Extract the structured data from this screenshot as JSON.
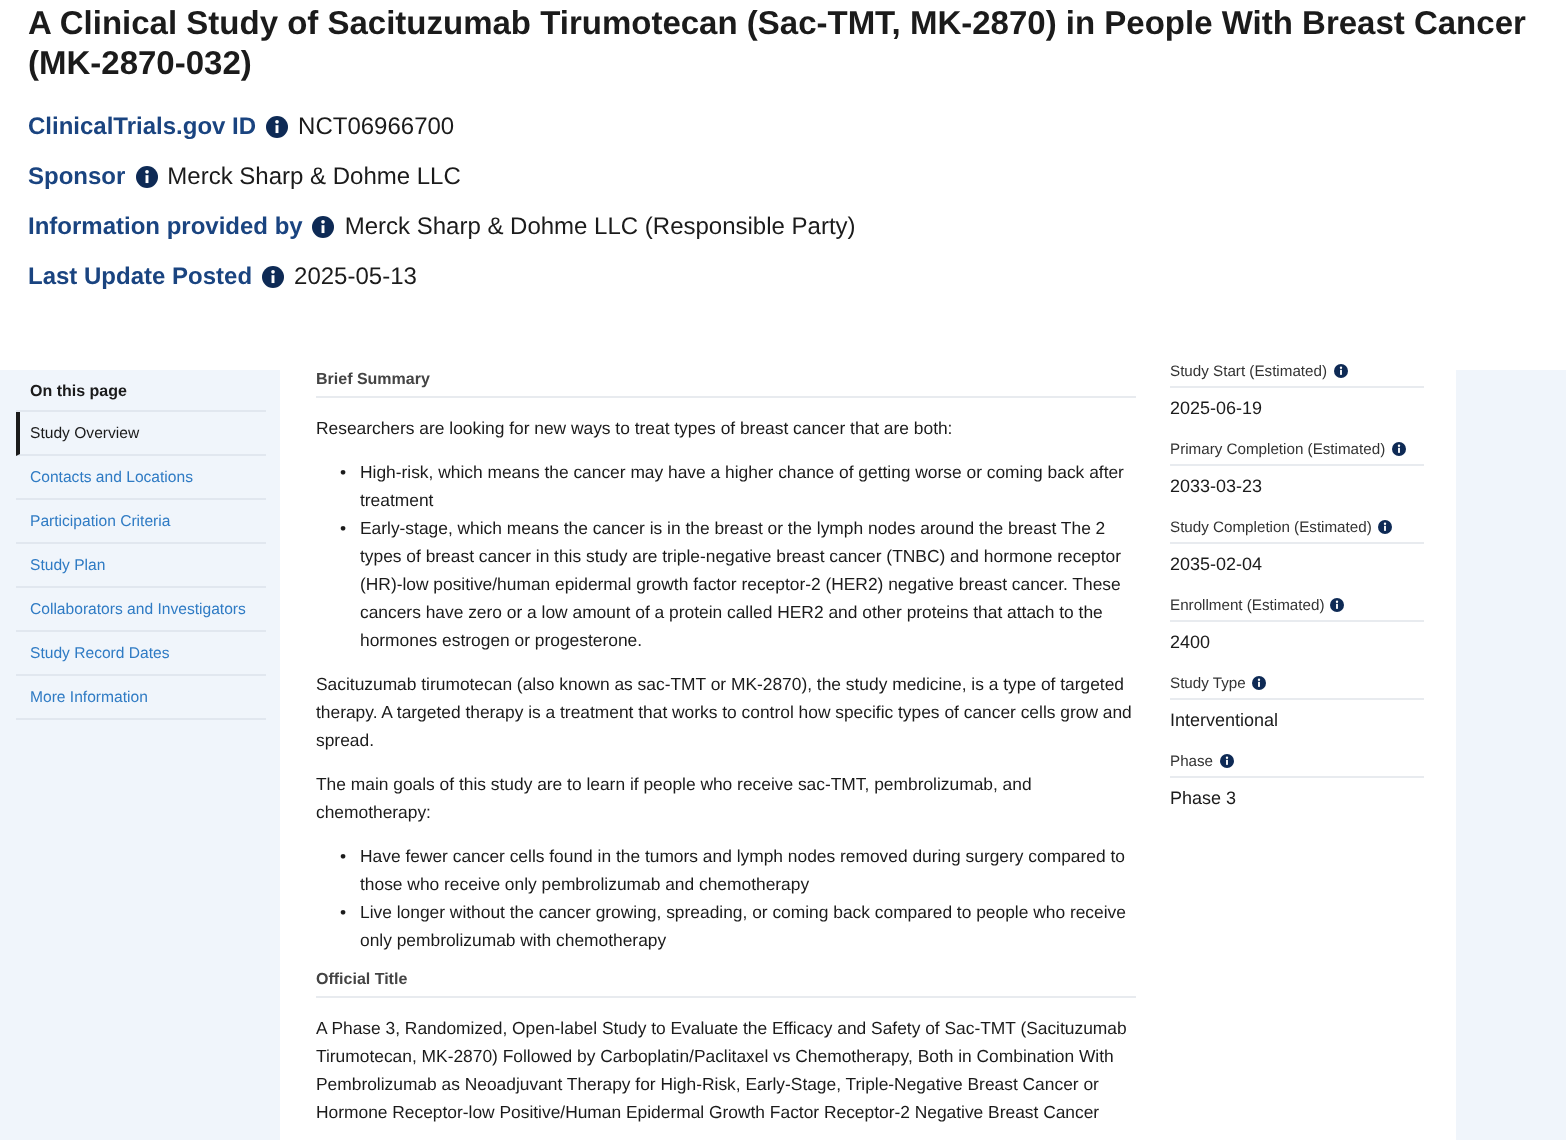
{
  "title": "A Clinical Study of Sacituzumab Tirumotecan (Sac-TMT, MK-2870) in People With Breast Cancer (MK-2870-032)",
  "meta": [
    {
      "label": "ClinicalTrials.gov ID",
      "value": "NCT06966700"
    },
    {
      "label": "Sponsor",
      "value": "Merck Sharp & Dohme LLC"
    },
    {
      "label": "Information provided by",
      "value": "Merck Sharp & Dohme LLC (Responsible Party)"
    },
    {
      "label": "Last Update Posted",
      "value": "2025-05-13"
    }
  ],
  "sidebar": {
    "heading": "On this page",
    "items": [
      {
        "label": "Study Overview",
        "selected": true
      },
      {
        "label": "Contacts and Locations",
        "selected": false
      },
      {
        "label": "Participation Criteria",
        "selected": false
      },
      {
        "label": "Study Plan",
        "selected": false
      },
      {
        "label": "Collaborators and Investigators",
        "selected": false
      },
      {
        "label": "Study Record Dates",
        "selected": false
      },
      {
        "label": "More Information",
        "selected": false
      }
    ]
  },
  "sections": [
    {
      "heading": "Brief Summary",
      "blocks": [
        {
          "kind": "paragraph",
          "text": "Researchers are looking for new ways to treat types of breast cancer that are both:"
        },
        {
          "kind": "list",
          "marker": "•",
          "items": [
            "High-risk, which means the cancer may have a higher chance of getting worse or coming back after treatment",
            "Early-stage, which means the cancer is in the breast or the lymph nodes around the breast The 2 types of breast cancer in this study are triple-negative breast cancer (TNBC) and hormone receptor (HR)-low positive/human epidermal growth factor receptor-2 (HER2) negative breast cancer. These cancers have zero or a low amount of a protein called HER2 and other proteins that attach to the hormones estrogen or progesterone."
          ]
        },
        {
          "kind": "paragraph",
          "text": "Sacituzumab tirumotecan (also known as sac-TMT or MK-2870), the study medicine, is a type of targeted therapy. A targeted therapy is a treatment that works to control how specific types of cancer cells grow and spread."
        },
        {
          "kind": "paragraph",
          "text": "The main goals of this study are to learn if people who receive sac-TMT, pembrolizumab, and chemotherapy:"
        },
        {
          "kind": "list",
          "marker": "•",
          "items": [
            "Have fewer cancer cells found in the tumors and lymph nodes removed during surgery compared to those who receive only pembrolizumab and chemotherapy",
            "Live longer without the cancer growing, spreading, or coming back compared to people who receive only pembrolizumab with chemotherapy"
          ]
        }
      ]
    },
    {
      "heading": "Official Title",
      "blocks": [
        {
          "kind": "paragraph",
          "text": "A Phase 3, Randomized, Open-label Study to Evaluate the Efficacy and Safety of Sac-TMT (Sacituzumab Tirumotecan, MK-2870) Followed by Carboplatin/Paclitaxel vs Chemotherapy, Both in Combination With Pembrolizumab as Neoadjuvant Therapy for High-Risk, Early-Stage, Triple-Negative Breast Cancer or Hormone Receptor-low Positive/Human Epidermal Growth Factor Receptor-2 Negative Breast Cancer"
        }
      ]
    }
  ],
  "facts": [
    {
      "label": "Study Start (Estimated)",
      "value": "2025-06-19"
    },
    {
      "label": "Primary Completion (Estimated)",
      "value": "2033-03-23"
    },
    {
      "label": "Study Completion (Estimated)",
      "value": "2035-02-04"
    },
    {
      "label": "Enrollment (Estimated)",
      "value": "2400"
    },
    {
      "label": "Study Type",
      "value": "Interventional"
    },
    {
      "label": "Phase",
      "value": "Phase 3"
    }
  ]
}
